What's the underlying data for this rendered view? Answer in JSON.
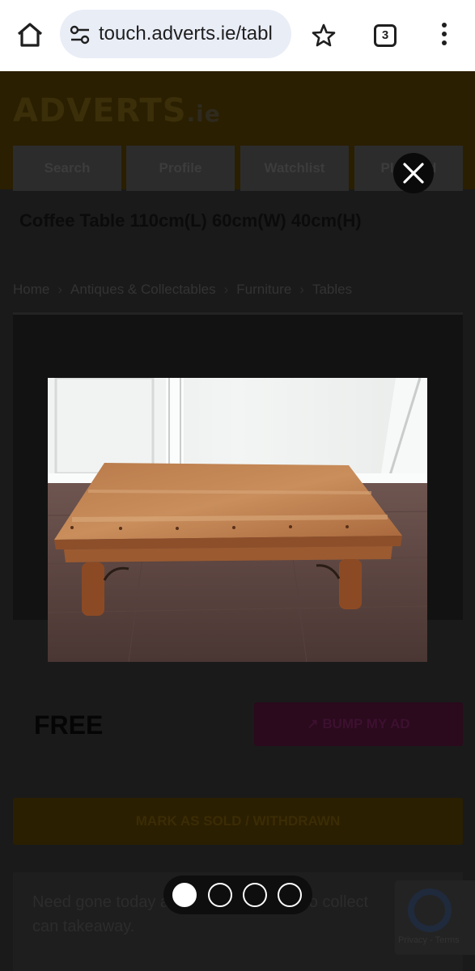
{
  "browser": {
    "url": "touch.adverts.ie/tabl",
    "tab_count": "3"
  },
  "site": {
    "logo_main": "ADVERTS",
    "logo_tld": ".ie",
    "nav": [
      "Search",
      "Profile",
      "Watchlist",
      "Place ad"
    ]
  },
  "listing": {
    "title": "Coffee Table 110cm(L) 60cm(W) 40cm(H)",
    "breadcrumbs": [
      "Home",
      "Antiques & Collectables",
      "Furniture",
      "Tables"
    ],
    "price": "FREE",
    "bump_label": "BUMP MY AD",
    "mark_sold_label": "MARK AS SOLD / WITHDRAWN",
    "description": "Need gone today as I'm moving. First to collect can takeaway."
  },
  "recaptcha": {
    "footer": "Privacy - Terms"
  },
  "gallery": {
    "current_image": 1,
    "total_images": 4,
    "image_subject": "wooden coffee table on laminate floor"
  },
  "icons": {
    "home": "home-icon",
    "site_settings": "tune-icon",
    "bookmark": "star-icon",
    "tabs": "tab-switcher-icon",
    "menu": "more-vert-icon",
    "close": "close-icon",
    "bump": "trending-up-icon"
  },
  "colors": {
    "overlay": "#000000",
    "dot_active": "#ffffff",
    "brand_orange": "#f5a300",
    "bump_magenta": "#c2185b"
  }
}
